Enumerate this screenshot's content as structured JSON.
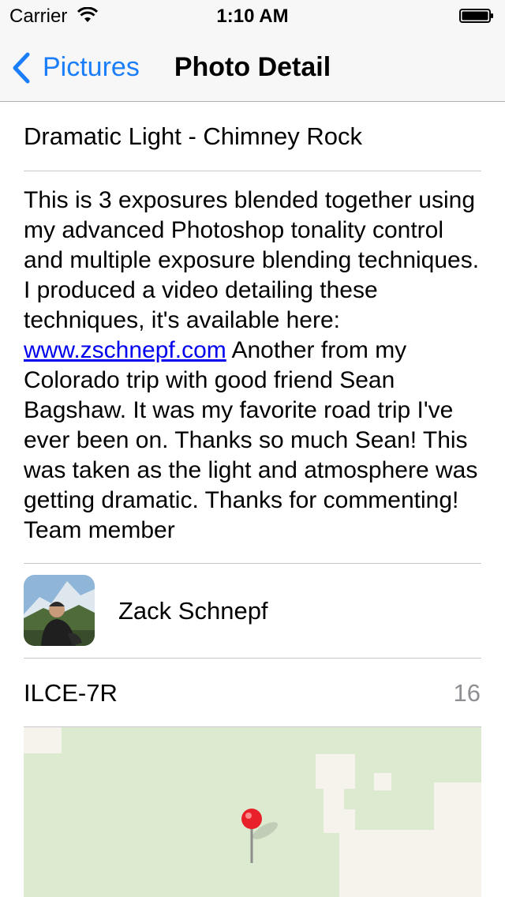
{
  "status_bar": {
    "carrier": "Carrier",
    "time": "1:10 AM",
    "icons": [
      "wifi-icon",
      "battery-icon"
    ]
  },
  "nav": {
    "back_label": "Pictures",
    "title": "Photo Detail",
    "accent_color": "#1a7dfa"
  },
  "photo": {
    "title": "Dramatic Light - Chimney Rock",
    "description_before_link": "This is 3 exposures blended together using my advanced Photoshop tonality control and multiple exposure blending techniques. I produced a video detailing these techniques, it's available here: ",
    "link_text": "www.zschnepf.com",
    "description_after_link": " Another from my Colorado trip with good friend Sean Bagshaw. It was my favorite road trip I've ever been on. Thanks so much Sean! This was taken as the light and atmosphere was getting dramatic. Thanks for commenting! Team member",
    "author": "Zack Schnepf",
    "camera": "ILCE-7R",
    "count": "16"
  },
  "map": {
    "pin_color": "#e8202a",
    "land_color": "#dcebd0",
    "building_color": "#f6f3ec"
  }
}
